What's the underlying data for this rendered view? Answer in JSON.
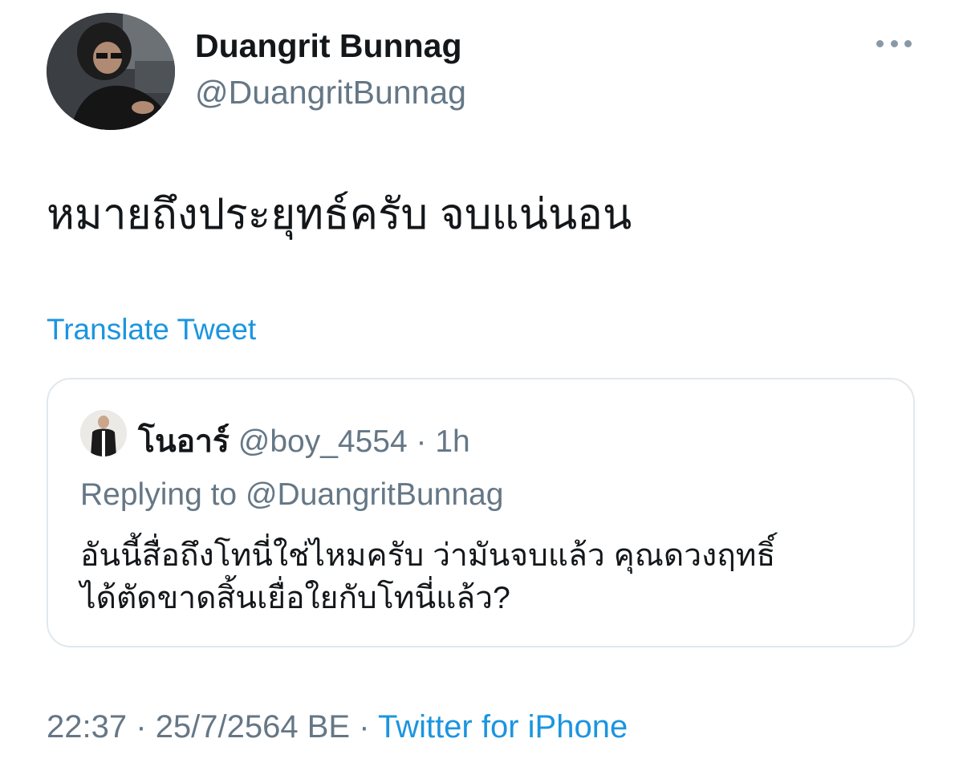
{
  "author": {
    "display_name": "Duangrit Bunnag",
    "handle": "@DuangritBunnag"
  },
  "tweet": {
    "text": "หมายถึงประยุทธ์ครับ จบแน่นอน",
    "translate_label": "Translate Tweet"
  },
  "quoted": {
    "display_name": "โนอาร์",
    "handle": "@boy_4554",
    "separator": "·",
    "time": "1h",
    "replying_to": "Replying to @DuangritBunnag",
    "text_line1": "อันนี้สื่อถึงโทนี่ใช่ไหมครับ ว่ามันจบแล้ว คุณดวงฤทธิ์",
    "text_line2": "ได้ตัดขาดสิ้นเยื่อใยกับโทนี่แล้ว?"
  },
  "footer": {
    "time": "22:37",
    "separator": "·",
    "date": "25/7/2564 BE",
    "source": "Twitter for iPhone"
  },
  "icons": {
    "more": "more-horizontal-icon"
  },
  "colors": {
    "link_blue": "#1b95e0",
    "muted_gray": "#657786",
    "border": "#e1e8ed",
    "text": "#14171a"
  }
}
